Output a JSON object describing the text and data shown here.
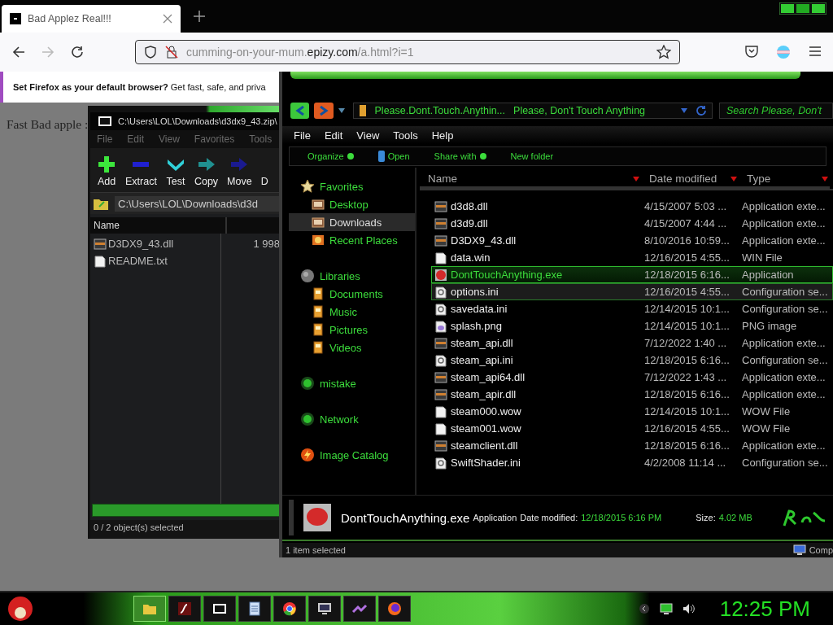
{
  "browser": {
    "tab": {
      "title": "Bad Applez Real!!!",
      "selected": true
    },
    "forward_enabled": false,
    "url": {
      "host_prefix": "cumming-on-your-mum.",
      "domain": "epizy.com",
      "path": "/a.html?i=1"
    },
    "notification": "**Set Firefox as your default browser?** Get fast, safe, and priva",
    "page_text": "Fast Bad apple :"
  },
  "archive_window": {
    "title": "C:\\Users\\LOL\\Downloads\\d3dx9_43.zip\\",
    "menu": [
      "File",
      "Edit",
      "View",
      "Favorites",
      "Tools"
    ],
    "toolbar": [
      {
        "label": "Add",
        "kind": "add"
      },
      {
        "label": "Extract",
        "kind": "extract"
      },
      {
        "label": "Test",
        "kind": "test"
      },
      {
        "label": "Copy",
        "kind": "copy"
      },
      {
        "label": "Move",
        "kind": "move"
      },
      {
        "label": "D",
        "kind": "covered"
      }
    ],
    "address": "C:\\Users\\LOL\\Downloads\\d3d",
    "columns": [
      "Name"
    ],
    "files": [
      {
        "name": "D3DX9_43.dll",
        "size": "1 998",
        "kind": "dll"
      },
      {
        "name": "README.txt",
        "kind": "page"
      }
    ],
    "status": "0 / 2 object(s) selected"
  },
  "explorer_window": {
    "address": [
      "Please.Dont.Touch.Anythin...",
      "Please, Don't Touch Anything"
    ],
    "search": {
      "placeholder": "Search Please, Don't"
    },
    "menu": [
      "File",
      "Edit",
      "View",
      "Tools",
      "Help"
    ],
    "commands": [
      {
        "label": "Organize",
        "kind": "menu"
      },
      {
        "label": "Open",
        "kind": "open"
      },
      {
        "label": "Share with",
        "kind": "menu"
      },
      {
        "label": "New folder",
        "kind": "plain"
      }
    ],
    "nav": [
      {
        "label": "Favorites",
        "kind": "star",
        "selected": false,
        "children": [
          {
            "label": "Desktop",
            "kind": "box",
            "selected": false
          },
          {
            "label": "Downloads",
            "kind": "box",
            "selected": true
          },
          {
            "label": "Recent Places",
            "kind": "clock",
            "selected": false
          }
        ]
      },
      {
        "label": "Libraries",
        "kind": "orb",
        "selected": false,
        "children": [
          {
            "label": "Documents",
            "kind": "page",
            "selected": false
          },
          {
            "label": "Music",
            "kind": "page",
            "selected": false
          },
          {
            "label": "Pictures",
            "kind": "page",
            "selected": false
          },
          {
            "label": "Videos",
            "kind": "page",
            "selected": false
          }
        ]
      },
      {
        "label": "mistake",
        "kind": "ball",
        "selected": false
      },
      {
        "label": "Network",
        "kind": "ball",
        "selected": false
      },
      {
        "label": "Image Catalog",
        "kind": "bolt",
        "selected": false
      }
    ],
    "columns": [
      "Name",
      "Date modified",
      "Type"
    ],
    "files": [
      {
        "name": "d3d8.dll",
        "date": "4/15/2007 5:03 ...",
        "type": "Application exte...",
        "kind": "dll",
        "selected": false,
        "hovered": false
      },
      {
        "name": "d3d9.dll",
        "date": "4/15/2007 4:44 ...",
        "type": "Application exte...",
        "kind": "dll",
        "selected": false,
        "hovered": false
      },
      {
        "name": "D3DX9_43.dll",
        "date": "8/10/2016 10:59...",
        "type": "Application exte...",
        "kind": "dll",
        "selected": false,
        "hovered": false
      },
      {
        "name": "data.win",
        "date": "12/16/2015 4:55...",
        "type": "WIN File",
        "kind": "page",
        "selected": false,
        "hovered": false
      },
      {
        "name": "DontTouchAnything.exe",
        "date": "12/18/2015 6:16...",
        "type": "Application",
        "kind": "button",
        "selected": true,
        "hovered": false
      },
      {
        "name": "options.ini",
        "date": "12/16/2015 4:55...",
        "type": "Configuration se...",
        "kind": "settings",
        "selected": false,
        "hovered": true
      },
      {
        "name": "savedata.ini",
        "date": "12/14/2015 10:1...",
        "type": "Configuration se...",
        "kind": "settings",
        "selected": false,
        "hovered": false
      },
      {
        "name": "splash.png",
        "date": "12/14/2015 10:1...",
        "type": "PNG image",
        "kind": "image",
        "selected": false,
        "hovered": false
      },
      {
        "name": "steam_api.dll",
        "date": "7/12/2022 1:40 ...",
        "type": "Application exte...",
        "kind": "dll",
        "selected": false,
        "hovered": false
      },
      {
        "name": "steam_api.ini",
        "date": "12/18/2015 6:16...",
        "type": "Configuration se...",
        "kind": "settings",
        "selected": false,
        "hovered": false
      },
      {
        "name": "steam_api64.dll",
        "date": "7/12/2022 1:43 ...",
        "type": "Application exte...",
        "kind": "dll",
        "selected": false,
        "hovered": false
      },
      {
        "name": "steam_apir.dll",
        "date": "12/18/2015 6:16...",
        "type": "Application exte...",
        "kind": "dll",
        "selected": false,
        "hovered": false
      },
      {
        "name": "steam000.wow",
        "date": "12/14/2015 10:1...",
        "type": "WOW File",
        "kind": "page",
        "selected": false,
        "hovered": false
      },
      {
        "name": "steam001.wow",
        "date": "12/16/2015 4:55...",
        "type": "WOW File",
        "kind": "page",
        "selected": false,
        "hovered": false
      },
      {
        "name": "steamclient.dll",
        "date": "12/18/2015 6:16...",
        "type": "Application exte...",
        "kind": "dll",
        "selected": false,
        "hovered": false
      },
      {
        "name": "SwiftShader.ini",
        "date": "4/2/2008 11:14 ...",
        "type": "Configuration se...",
        "kind": "settings",
        "selected": false,
        "hovered": false
      }
    ],
    "details": {
      "name": "DontTouchAnything.exe",
      "type": "Application",
      "date_label": "Date modified:",
      "date": "12/18/2015 6:16 PM",
      "size_label": "Size:",
      "size": "4.02 MB"
    },
    "status": "1 item selected",
    "status_location": "Comp"
  },
  "taskbar": {
    "apps": [
      {
        "kind": "folder",
        "selected": true
      },
      {
        "kind": "flash",
        "selected": false
      },
      {
        "kind": "archive",
        "selected": false
      },
      {
        "kind": "notepad",
        "selected": false
      },
      {
        "kind": "chrome",
        "selected": false
      },
      {
        "kind": "monitor",
        "selected": false
      },
      {
        "kind": "purple",
        "selected": false
      },
      {
        "kind": "firefox",
        "selected": false
      }
    ],
    "clock": "12:25 PM"
  }
}
